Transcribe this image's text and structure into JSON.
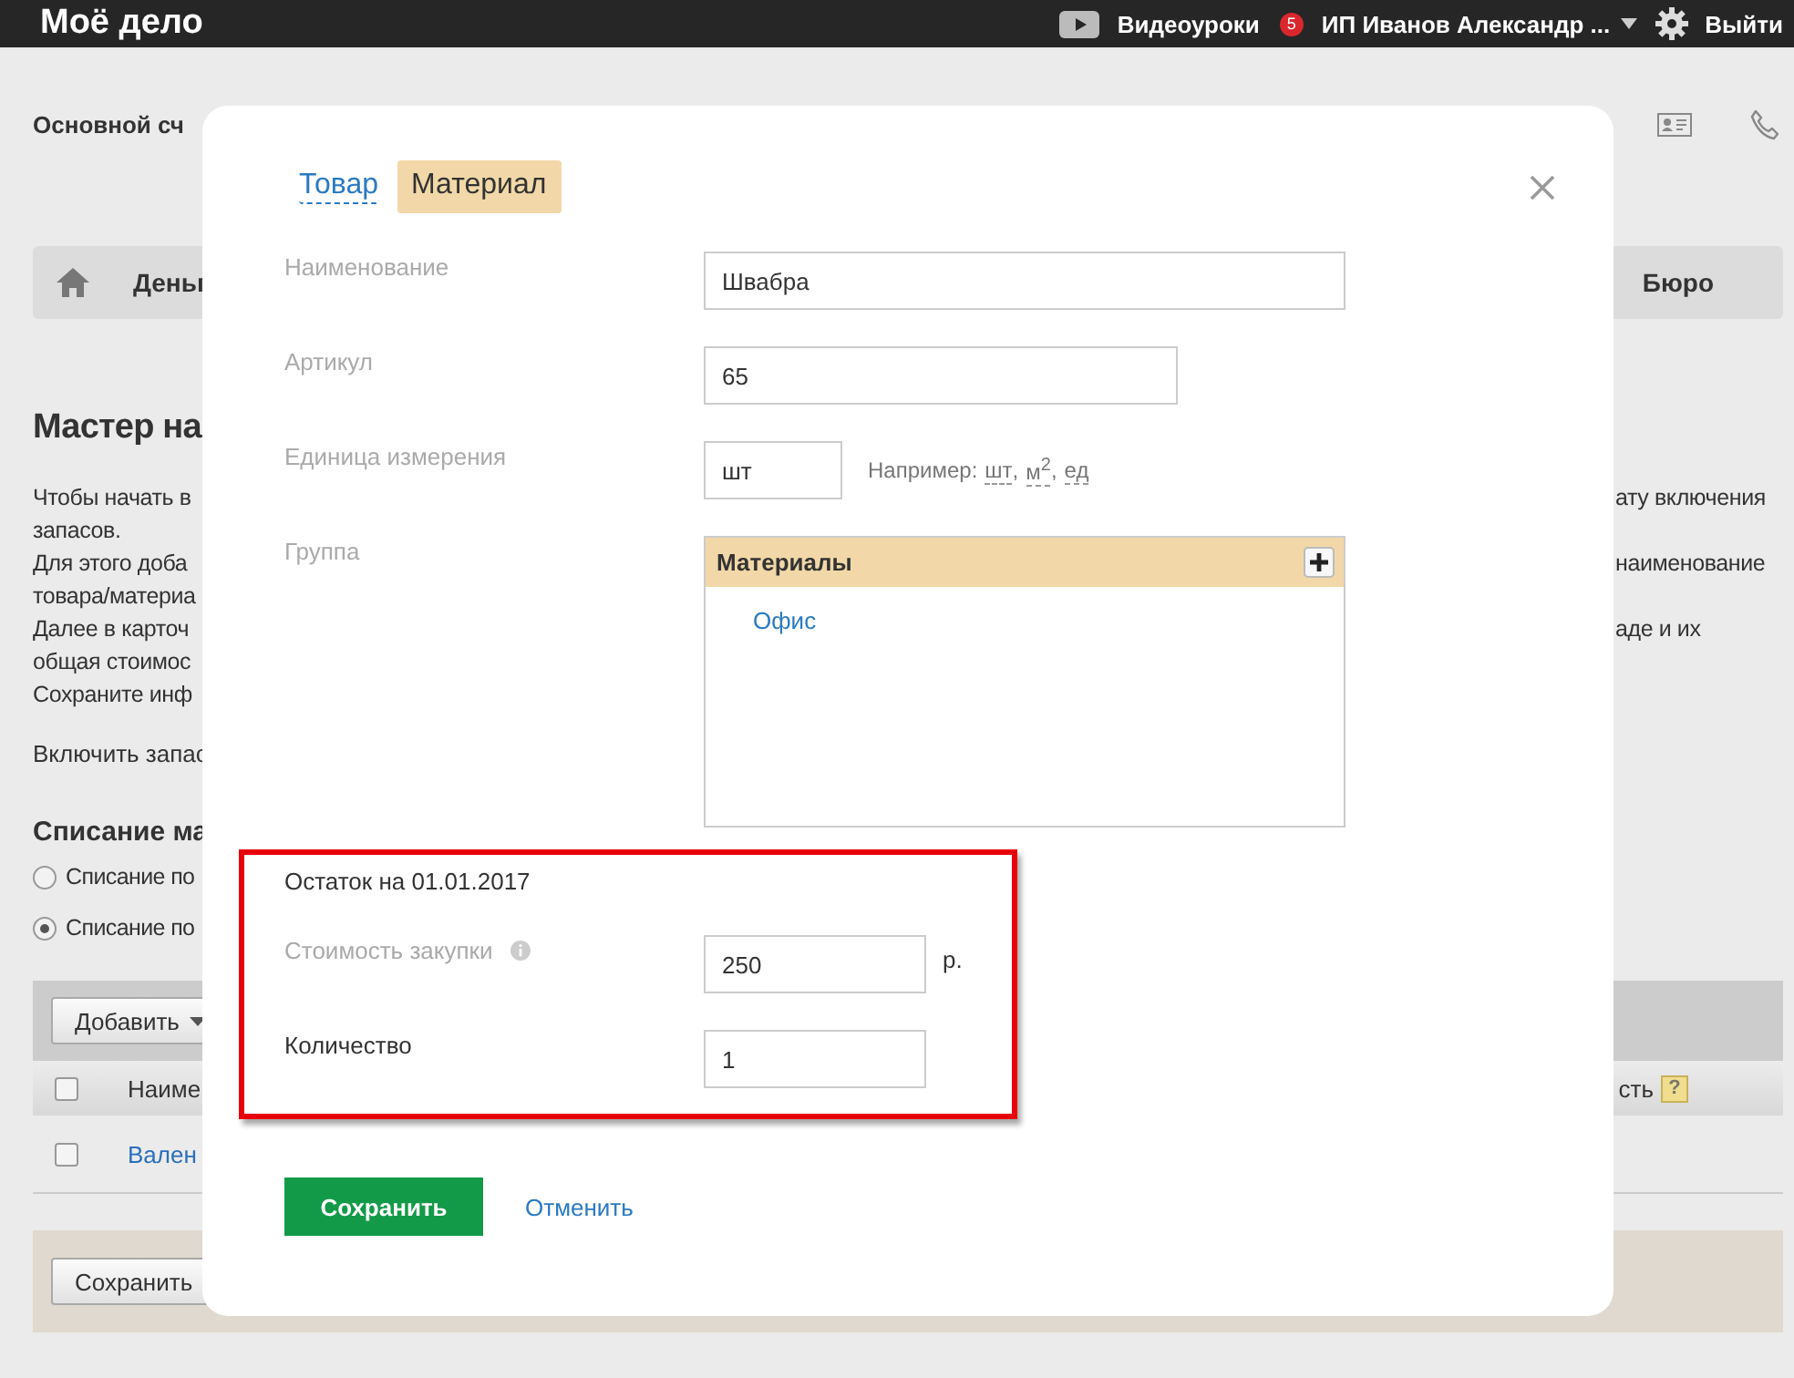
{
  "header": {
    "logo": "Моё дело",
    "video_link": "Видеоуроки",
    "notification_count": "5",
    "user_menu": "ИП Иванов Александр ...",
    "logout": "Выйти"
  },
  "background": {
    "account_title": "Основной сч",
    "nav": {
      "left_item": "Деньг",
      "right_item": "Бюро"
    },
    "heading": "Мастер на",
    "paragraph_lines": [
      {
        "left": "Чтобы начать в",
        "right": "ату включения"
      },
      {
        "left": "запасов."
      },
      {
        "left": "Для этого доба",
        "right": "наименование"
      },
      {
        "left": "товара/материа"
      },
      {
        "left": "Далее в карточ",
        "right": "аде и их"
      },
      {
        "left": "общая стоимос"
      },
      {
        "left": "Сохраните инф"
      }
    ],
    "enable_line": "Включить запас",
    "writeoff": {
      "title": "Списание ма",
      "options": [
        {
          "label": "Списание по",
          "selected": false
        },
        {
          "label": "Списание по",
          "selected": true
        }
      ]
    },
    "table": {
      "add_button": "Добавить",
      "header_checked": false,
      "columns": [
        "Наиме",
        "сть"
      ],
      "help_mark": "?",
      "rows": [
        {
          "name": "Вален",
          "checked": false
        }
      ]
    },
    "save_button": "Сохранить"
  },
  "dialog": {
    "tabs": [
      {
        "label": "Товар",
        "selected": false
      },
      {
        "label": "Материал",
        "selected": true
      }
    ],
    "name": {
      "label": "Наименование",
      "muted": true,
      "value": "Швабра"
    },
    "article": {
      "label": "Артикул",
      "muted": true,
      "value": "65"
    },
    "unit": {
      "label": "Единица измерения",
      "muted": true,
      "value": "шт",
      "hint_prefix": "Например:",
      "examples": [
        {
          "text": "шт",
          "suffix": ","
        },
        {
          "text": "м$^{2}$",
          "suffix": ","
        },
        {
          "text": "ед"
        }
      ]
    },
    "group": {
      "label": "Группа",
      "muted": true,
      "tree_title": "Материалы",
      "items": [
        "Офис"
      ]
    },
    "balance": {
      "title": "Остаток на 01.01.2017",
      "cost": {
        "label": "Стоимость закупки",
        "muted": true,
        "value": "250",
        "unit": "р."
      },
      "quantity": {
        "label": "Количество",
        "muted": false,
        "value": "1"
      }
    },
    "save_button": "Сохранить",
    "cancel_link": "Отменить"
  }
}
